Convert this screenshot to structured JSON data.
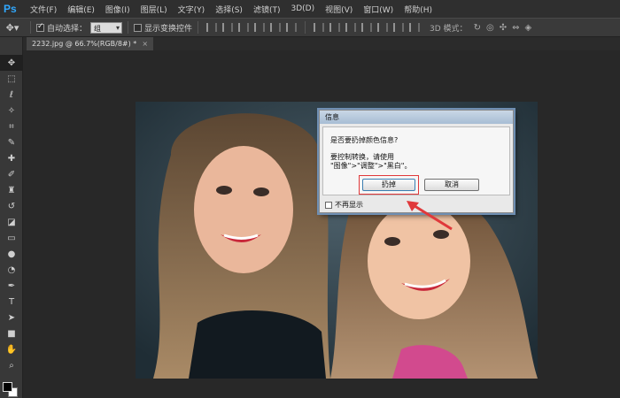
{
  "app": {
    "logo": "Ps"
  },
  "menu": [
    "文件(F)",
    "编辑(E)",
    "图像(I)",
    "图层(L)",
    "文字(Y)",
    "选择(S)",
    "滤镜(T)",
    "3D(D)",
    "视图(V)",
    "窗口(W)",
    "帮助(H)"
  ],
  "options_bar": {
    "auto_select_label": "自动选择：",
    "auto_select_checked": true,
    "group_value": "组",
    "show_transform_label": "显示变换控件",
    "mode_label": "3D 模式："
  },
  "document": {
    "tab_title": "2232.jpg @ 66.7%(RGB/8#) *",
    "close_glyph": "×"
  },
  "dialog": {
    "title": "信息",
    "question": "是否要扔掉颜色信息?",
    "hint_line1": "要控制转换，请使用",
    "hint_line2": "\"图像\">\"调整\">\"黑白\"。",
    "discard_label": "扔掉",
    "cancel_label": "取消",
    "dont_show_label": "不再显示"
  },
  "colors": {
    "highlight": "#e0393b",
    "accent": "#31a8ff"
  },
  "icons": [
    "move-icon",
    "marquee-icon",
    "lasso-icon",
    "quick-select-icon",
    "crop-icon",
    "eyedropper-icon",
    "healing-brush-icon",
    "brush-icon",
    "clone-stamp-icon",
    "history-brush-icon",
    "eraser-icon",
    "gradient-icon",
    "blur-icon",
    "dodge-icon",
    "pen-icon",
    "type-icon",
    "path-select-icon",
    "rectangle-icon",
    "hand-icon",
    "zoom-icon"
  ]
}
